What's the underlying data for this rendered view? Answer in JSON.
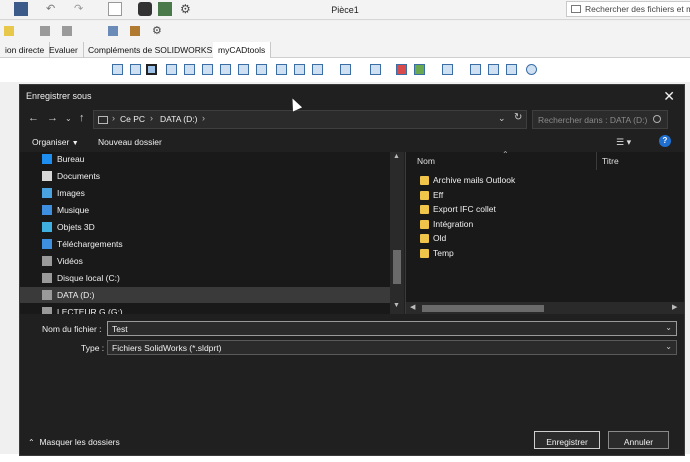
{
  "solidworks": {
    "title": "Pièce1",
    "search_placeholder": "Rechercher des fichiers et mo",
    "tabs": [
      "ion directe",
      "Evaluer",
      "Compléments de SOLIDWORKS",
      "myCADtools"
    ],
    "colors": {
      "accent": "#3b6ea5"
    }
  },
  "dialog": {
    "title": "Enregistrer sous",
    "close_icon": "✕",
    "breadcrumb": [
      "Ce PC",
      "DATA (D:)"
    ],
    "search_placeholder": "Rechercher dans : DATA (D:)",
    "toolbar": {
      "organize": "Organiser",
      "new_folder": "Nouveau dossier"
    },
    "nav_items": [
      {
        "label": "Bureau",
        "icon": "desktop-icon",
        "color": "#1f8ef1"
      },
      {
        "label": "Documents",
        "icon": "documents-icon",
        "color": "#d8d8d8"
      },
      {
        "label": "Images",
        "icon": "images-icon",
        "color": "#4aa3df"
      },
      {
        "label": "Musique",
        "icon": "music-icon",
        "color": "#3f8fe0"
      },
      {
        "label": "Objets 3D",
        "icon": "objects3d-icon",
        "color": "#3fb0e0"
      },
      {
        "label": "Téléchargements",
        "icon": "download-icon",
        "color": "#3f8fe0"
      },
      {
        "label": "Vidéos",
        "icon": "videos-icon",
        "color": "#9a9a9a"
      },
      {
        "label": "Disque local (C:)",
        "icon": "drive-icon",
        "color": "#9a9a9a"
      },
      {
        "label": "DATA (D:)",
        "icon": "drive-icon",
        "color": "#9a9a9a",
        "selected": true
      },
      {
        "label": "LECTEUR G (G:)",
        "icon": "drive-icon",
        "color": "#9a9a9a"
      }
    ],
    "columns": {
      "name": "Nom",
      "title": "Titre"
    },
    "files": [
      "Archive mails Outlook",
      "Eff",
      "Export IFC collet",
      "Intégration",
      "Old",
      "Temp"
    ],
    "form": {
      "filename_label": "Nom du fichier :",
      "filename_value": "Test",
      "type_label": "Type :",
      "type_value": "Fichiers SolidWorks (*.sldprt)"
    },
    "hide_folders": "Masquer les dossiers",
    "buttons": {
      "save": "Enregistrer",
      "cancel": "Annuler"
    }
  }
}
